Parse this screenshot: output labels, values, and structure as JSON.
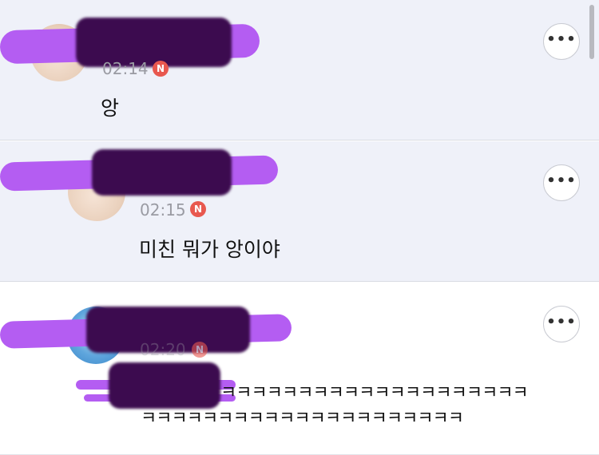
{
  "comments": [
    {
      "time": "02:14",
      "badge": "N",
      "text": "앙",
      "more": "•••"
    },
    {
      "time": "02:15",
      "badge": "N",
      "text": "미친 뭐가 앙이야",
      "more": "•••"
    },
    {
      "time": "02:20",
      "badge": "N",
      "text_line1": "ㅋㅋㅋㅋㅋㅋㅋㅋㅋㅋㅋㅋㅋㅋㅋㅋㅋㅋㅋㅋ",
      "text_line2": "ㅋㅋㅋㅋㅋㅋㅋㅋㅋㅋㅋㅋㅋㅋㅋㅋㅋㅋㅋㅋㅋ",
      "more": "•••"
    }
  ],
  "colors": {
    "badge": "#e8584f",
    "redact_purple": "#b45df2",
    "redact_dark": "#3c0b4f"
  }
}
